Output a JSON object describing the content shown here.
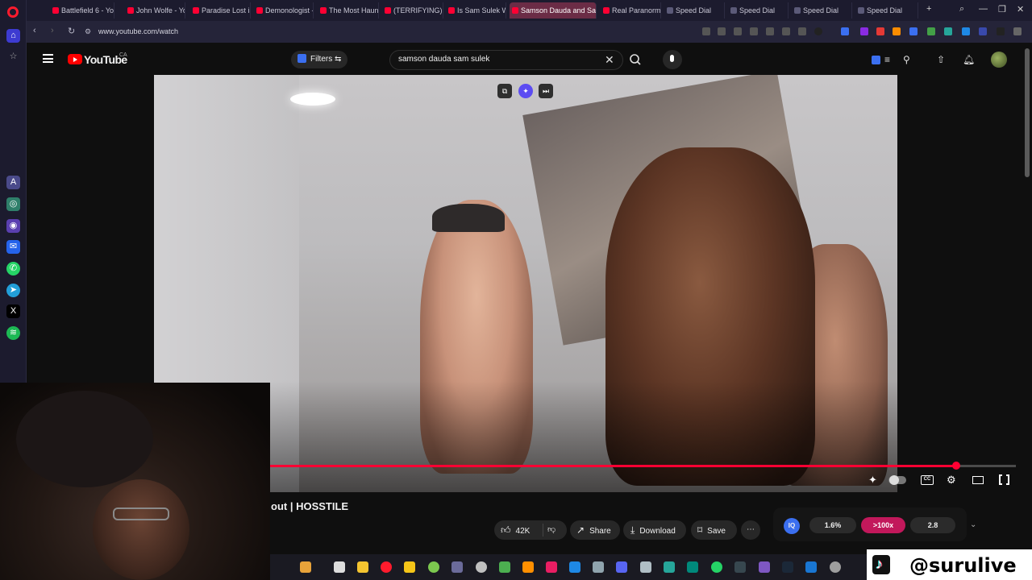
{
  "browser": {
    "tabs": [
      {
        "label": "Battlefield 6 - Yo",
        "kind": "yt"
      },
      {
        "label": "John Wolfe - You",
        "kind": "yt"
      },
      {
        "label": "Paradise Lost is",
        "kind": "yt"
      },
      {
        "label": "Demonologist -",
        "kind": "yt"
      },
      {
        "label": "The Most Haunt",
        "kind": "yt"
      },
      {
        "label": "(TERRIFYING) DE",
        "kind": "yt"
      },
      {
        "label": "Is Sam Sulek Wo",
        "kind": "yt"
      },
      {
        "label": "Samson Dauda and Sam",
        "kind": "yt",
        "active": true
      },
      {
        "label": "Real Paranormal",
        "kind": "yt"
      },
      {
        "label": "Speed Dial",
        "kind": "sd"
      },
      {
        "label": "Speed Dial",
        "kind": "sd"
      },
      {
        "label": "Speed Dial",
        "kind": "sd"
      },
      {
        "label": "Speed Dial",
        "kind": "sd"
      }
    ],
    "url": "www.youtube.com/watch"
  },
  "youtube": {
    "logo_text": "YouTube",
    "country": "CA",
    "filters_label": "Filters",
    "search_value": "samson dauda sam sulek",
    "video": {
      "title_visible": "out | HOSSTILE",
      "progress_fraction": 0.92
    },
    "actions": {
      "likes": "42K",
      "share": "Share",
      "download": "Download",
      "save": "Save"
    },
    "iq": {
      "badge": "IQ",
      "chip1": "1.6%",
      "chip2": ">100x",
      "chip3": "2.8"
    }
  },
  "overlay": {
    "handle": "@surulive"
  },
  "colors": {
    "accent": "#ff0033",
    "chip_highlight": "#c2185b",
    "iq_blue": "#3b6ff0"
  }
}
